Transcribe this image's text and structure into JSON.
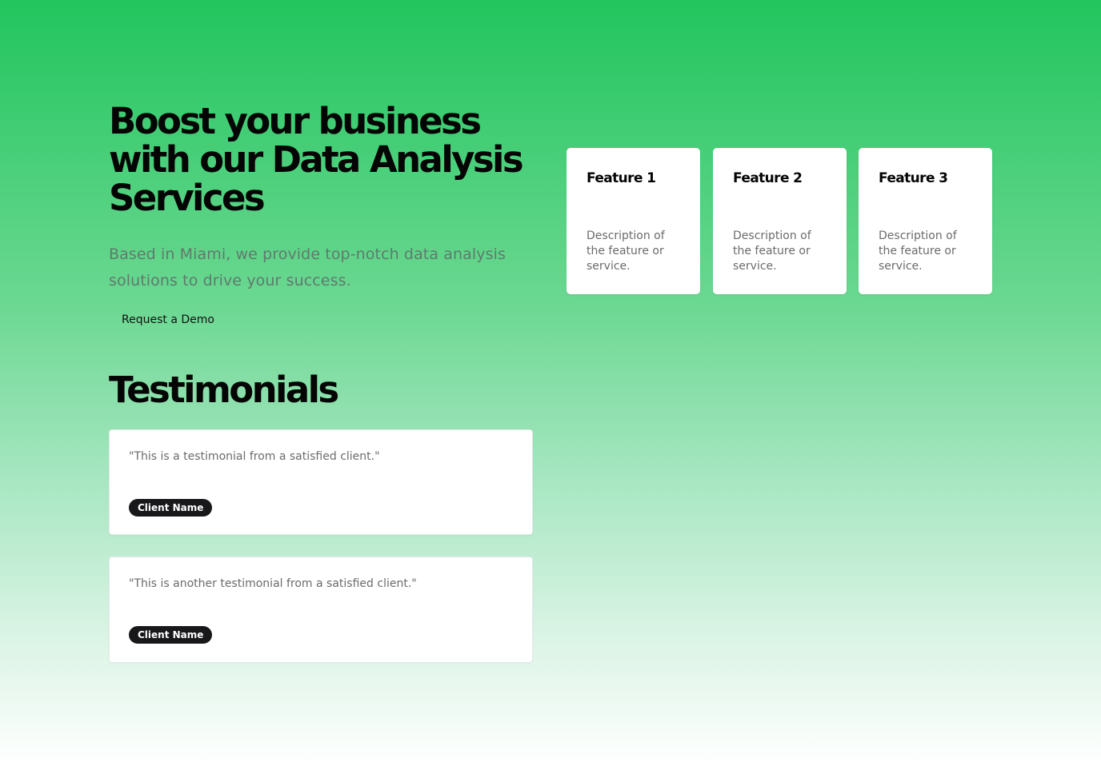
{
  "hero": {
    "headline": "Boost your business with our Data Analysis Services",
    "subtitle": "Based in Miami, we provide top-notch data analysis solutions to drive your success.",
    "cta_label": "Request a Demo"
  },
  "features": [
    {
      "title": "Feature 1",
      "description": "Description of the feature or service."
    },
    {
      "title": "Feature 2",
      "description": "Description of the feature or service."
    },
    {
      "title": "Feature 3",
      "description": "Description of the feature or service."
    }
  ],
  "testimonials": {
    "title": "Testimonials",
    "items": [
      {
        "quote": "\"This is a testimonial from a satisfied client.\"",
        "client": "Client Name"
      },
      {
        "quote": "\"This is another testimonial from a satisfied client.\"",
        "client": "Client Name"
      }
    ]
  },
  "colors": {
    "gradient_top": "#22c55e",
    "gradient_bottom": "#ffffff",
    "badge_background": "#18181b"
  }
}
